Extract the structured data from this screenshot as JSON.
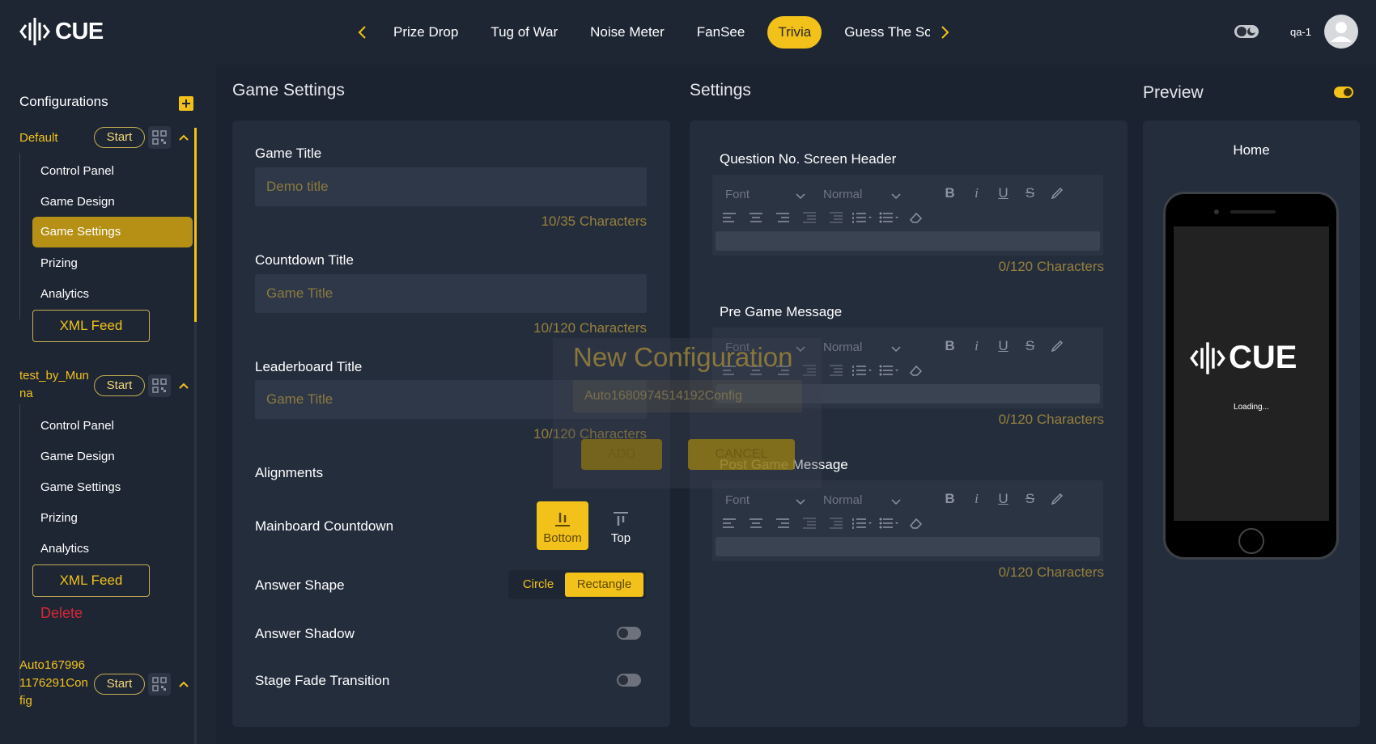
{
  "header": {
    "logo_text": "CUE",
    "nav_items": [
      "Prize Drop",
      "Tug of War",
      "Noise Meter",
      "FanSee",
      "Trivia",
      "Guess The Sco"
    ],
    "active_nav": "Trivia",
    "user_label": "qa-1"
  },
  "sidebar": {
    "title": "Configurations",
    "configs": [
      {
        "name": "Default",
        "start_label": "Start",
        "items": [
          "Control Panel",
          "Game Design",
          "Game Settings",
          "Prizing",
          "Analytics"
        ],
        "active_item": "Game Settings",
        "xml_label": "XML Feed"
      },
      {
        "name_line1": "test_by_Mun",
        "name_line2": "na",
        "start_label": "Start",
        "items": [
          "Control Panel",
          "Game Design",
          "Game Settings",
          "Prizing",
          "Analytics"
        ],
        "xml_label": "XML Feed",
        "delete_label": "Delete"
      },
      {
        "name_line1": "Auto167996",
        "name_line2": "1176291Con",
        "name_line3": "fig",
        "start_label": "Start"
      }
    ]
  },
  "game_settings": {
    "title": "Game Settings",
    "game_title_label": "Game Title",
    "game_title_placeholder": "Demo title",
    "game_title_count": "10/35 Characters",
    "countdown_title_label": "Countdown Title",
    "countdown_title_placeholder": "Game Title",
    "countdown_title_count": "10/120 Characters",
    "leaderboard_title_label": "Leaderboard Title",
    "leaderboard_title_placeholder": "Game Title",
    "leaderboard_title_count": "10/120 Characters",
    "alignments_label": "Alignments",
    "mainboard_countdown_label": "Mainboard Countdown",
    "bottom_label": "Bottom",
    "top_label": "Top",
    "answer_shape_label": "Answer Shape",
    "circle_label": "Circle",
    "rectangle_label": "Rectangle",
    "answer_shadow_label": "Answer Shadow",
    "stage_fade_label": "Stage Fade Transition"
  },
  "settings": {
    "title": "Settings",
    "editors": [
      {
        "label": "Question No. Screen Header",
        "font": "Font",
        "size": "Normal",
        "count": "0/120 Characters"
      },
      {
        "label": "Pre Game Message",
        "font": "Font",
        "size": "Normal",
        "count": "0/120 Characters"
      },
      {
        "label": "Post Game Message",
        "font": "Font",
        "size": "Normal",
        "count": "0/120 Characters"
      }
    ]
  },
  "preview": {
    "title": "Preview",
    "screen_label": "Home",
    "logo_text": "CUE",
    "loading_text": "Loading..."
  },
  "modal": {
    "title": "New Configuration",
    "input_value": "Auto1680974514192Config",
    "add_label": "ADD",
    "cancel_label": "CANCEL"
  },
  "colors": {
    "accent": "#f2c21a",
    "background": "#1b2230",
    "panel": "#242d3c",
    "danger": "#d82636"
  }
}
